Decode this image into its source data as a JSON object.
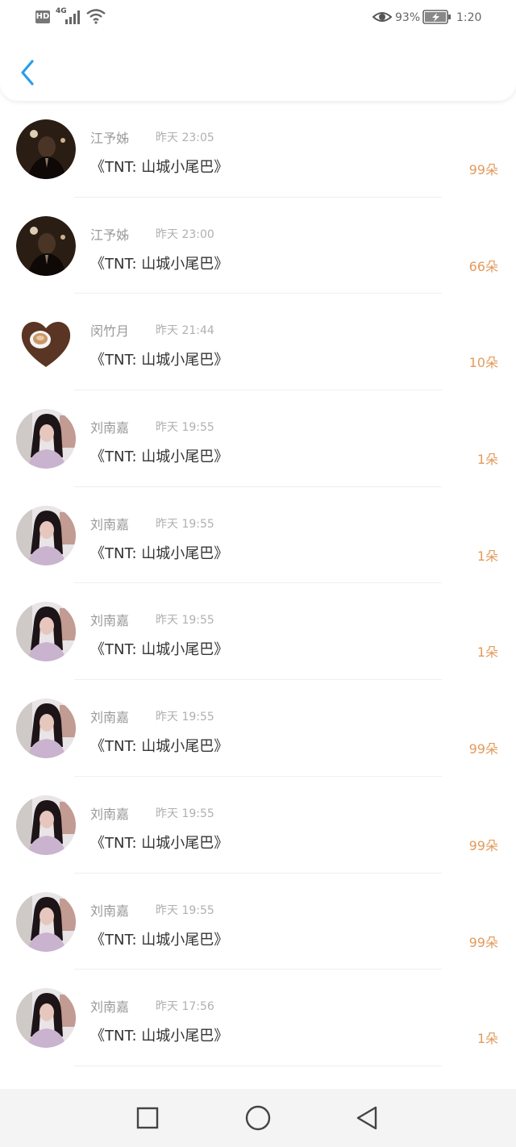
{
  "status_bar": {
    "hd": "HD",
    "network": "4G",
    "battery_percent": "93%",
    "time": "1:20"
  },
  "header": {
    "back_icon": "chevron-left-icon",
    "accent_color": "#2a9ee8"
  },
  "gifts": [
    {
      "name": "江予姊",
      "time": "昨天 23:05",
      "title": "《TNT: 山城小尾巴》",
      "count": "99朵",
      "avatar": "dark-photo"
    },
    {
      "name": "江予姊",
      "time": "昨天 23:00",
      "title": "《TNT: 山城小尾巴》",
      "count": "66朵",
      "avatar": "dark-photo"
    },
    {
      "name": "闵竹月",
      "time": "昨天 21:44",
      "title": "《TNT: 山城小尾巴》",
      "count": "10朵",
      "avatar": "coffee-heart"
    },
    {
      "name": "刘南嘉",
      "time": "昨天 19:55",
      "title": "《TNT: 山城小尾巴》",
      "count": "1朵",
      "avatar": "girl-photo"
    },
    {
      "name": "刘南嘉",
      "time": "昨天 19:55",
      "title": "《TNT: 山城小尾巴》",
      "count": "1朵",
      "avatar": "girl-photo"
    },
    {
      "name": "刘南嘉",
      "time": "昨天 19:55",
      "title": "《TNT: 山城小尾巴》",
      "count": "1朵",
      "avatar": "girl-photo"
    },
    {
      "name": "刘南嘉",
      "time": "昨天 19:55",
      "title": "《TNT: 山城小尾巴》",
      "count": "99朵",
      "avatar": "girl-photo"
    },
    {
      "name": "刘南嘉",
      "time": "昨天 19:55",
      "title": "《TNT: 山城小尾巴》",
      "count": "99朵",
      "avatar": "girl-photo"
    },
    {
      "name": "刘南嘉",
      "time": "昨天 19:55",
      "title": "《TNT: 山城小尾巴》",
      "count": "99朵",
      "avatar": "girl-photo"
    },
    {
      "name": "刘南嘉",
      "time": "昨天 17:56",
      "title": "《TNT: 山城小尾巴》",
      "count": "1朵",
      "avatar": "girl-photo"
    }
  ],
  "nav_bar": {
    "recents_icon": "square-icon",
    "home_icon": "circle-icon",
    "back_icon": "triangle-back-icon"
  }
}
